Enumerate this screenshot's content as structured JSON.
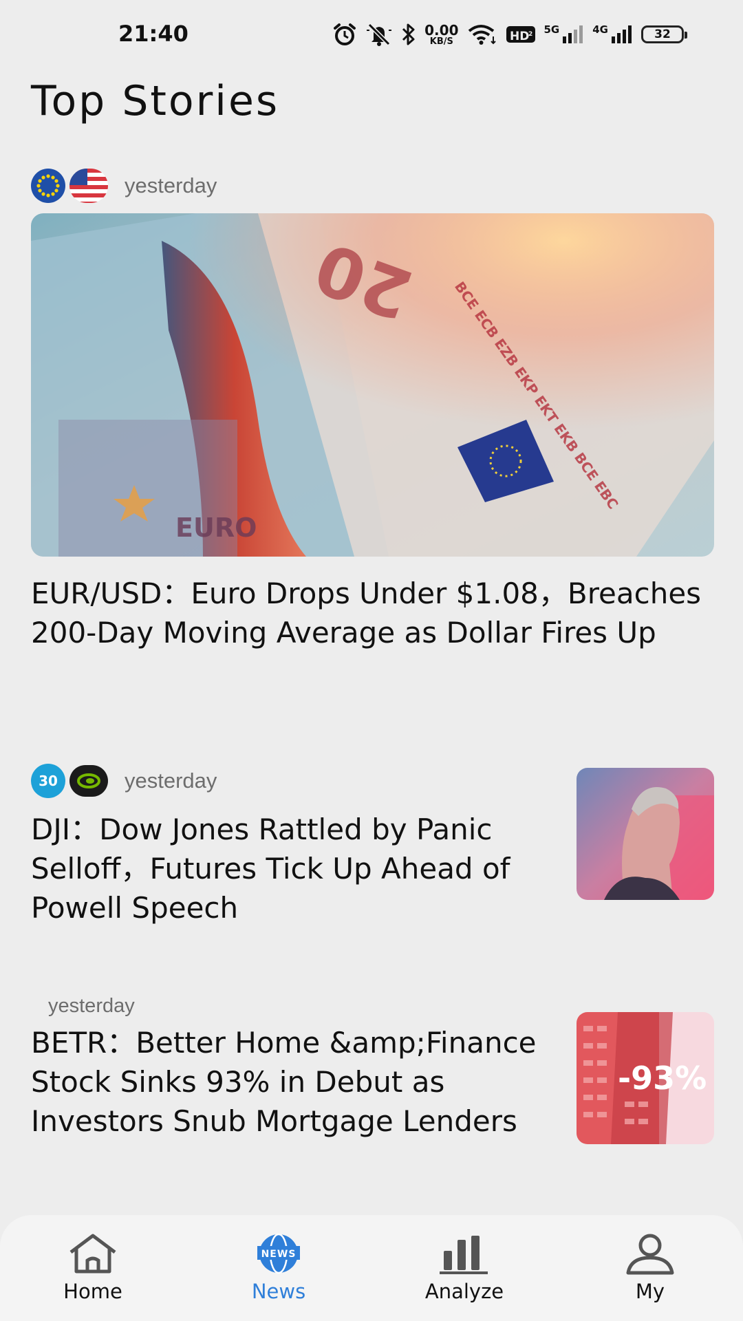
{
  "status_bar": {
    "time": "21:40",
    "net_speed_value": "0.00",
    "net_speed_unit": "KB/S",
    "hd_badge": "HD",
    "signal1_label": "5G",
    "signal2_label": "4G",
    "battery": "32"
  },
  "page": {
    "title": "Top Stories"
  },
  "stories": [
    {
      "time": "yesterday",
      "headline": "EUR/USD：Euro Drops Under $1.08，Breaches 200-Day Moving Average as Dollar Fires Up",
      "logos": [
        "eu-flag-icon",
        "us-flag-icon"
      ],
      "image": "euro-banknote-image"
    },
    {
      "time": "yesterday",
      "headline": "DJI：Dow Jones Rattled by Panic Selloff，Futures Tick Up Ahead of Powell Speech",
      "logos": [
        "dow30-icon",
        "nvidia-logo-icon"
      ],
      "badge_text": "30",
      "image": "speaker-portrait-image"
    },
    {
      "time": "yesterday",
      "headline": "BETR：Better Home &amp;Finance Stock Sinks 93% in Debut as Investors Snub Mortgage Lenders",
      "image_text": "-93%",
      "image": "building-red-image"
    }
  ],
  "nav": {
    "items": [
      {
        "label": "Home",
        "icon": "home-icon",
        "active": false
      },
      {
        "label": "News",
        "icon": "news-globe-icon",
        "active": true,
        "icon_text": "NEWS"
      },
      {
        "label": "Analyze",
        "icon": "bar-chart-icon",
        "active": false
      },
      {
        "label": "My",
        "icon": "user-icon",
        "active": false
      }
    ]
  },
  "colors": {
    "background": "#ededed",
    "accent": "#2f7fd9",
    "meta_text": "#6d6d6d"
  }
}
